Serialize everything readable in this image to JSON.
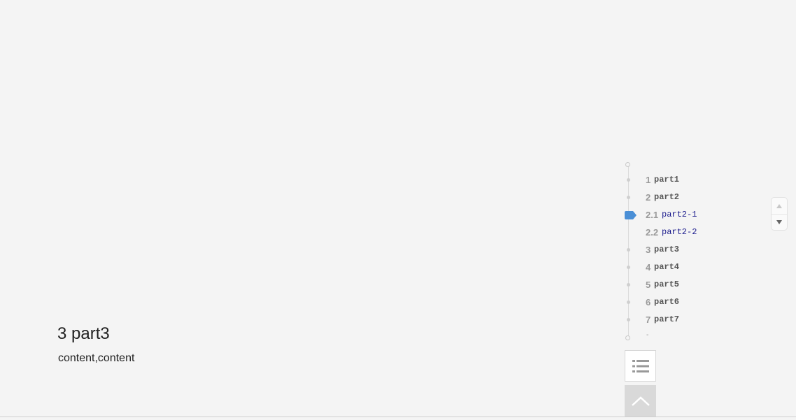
{
  "section": {
    "heading": "3 part3",
    "body": "content,content"
  },
  "catalog": {
    "items": [
      {
        "num": "1",
        "label": "part1",
        "level": 1,
        "active": false
      },
      {
        "num": "2",
        "label": "part2",
        "level": 1,
        "active": false
      },
      {
        "num": "2.1",
        "label": "part2-1",
        "level": 2,
        "active": true
      },
      {
        "num": "2.2",
        "label": "part2-2",
        "level": 2,
        "active": false
      },
      {
        "num": "3",
        "label": "part3",
        "level": 1,
        "active": false
      },
      {
        "num": "4",
        "label": "part4",
        "level": 1,
        "active": false
      },
      {
        "num": "5",
        "label": "part5",
        "level": 1,
        "active": false
      },
      {
        "num": "6",
        "label": "part6",
        "level": 1,
        "active": false
      },
      {
        "num": "7",
        "label": "part7",
        "level": 1,
        "active": false
      }
    ],
    "trailing_text": "-",
    "active_color": "#4a8fd6"
  },
  "controls": {
    "scroll_up_icon": "triangle-up-icon",
    "scroll_down_icon": "triangle-down-icon",
    "catalog_toggle_icon": "list-icon",
    "back_to_top_icon": "chevron-up-icon"
  }
}
